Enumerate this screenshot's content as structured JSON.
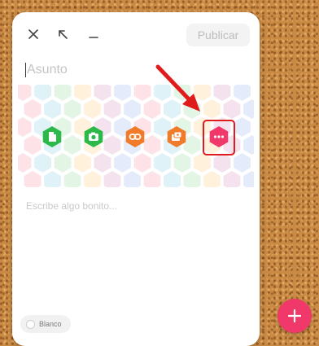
{
  "toolbar": {
    "close_icon": "close-icon",
    "expand_icon": "expand-arrow-icon",
    "minimize_icon": "minimize-icon",
    "publish_label": "Publicar"
  },
  "post": {
    "subject_placeholder": "Asunto",
    "body_placeholder": "Escribe algo bonito..."
  },
  "attachments": [
    {
      "icon": "document-icon",
      "color": "#2db84a"
    },
    {
      "icon": "camera-icon",
      "color": "#2db84a"
    },
    {
      "icon": "link-icon",
      "color": "#f07b2a"
    },
    {
      "icon": "photo-gallery-icon",
      "color": "#f07b2a"
    },
    {
      "icon": "more-options-icon",
      "color": "#f0386b"
    }
  ],
  "background_option": {
    "label": "Blanco"
  },
  "colors": {
    "accent": "#f0386b",
    "annotation": "#e01b1b"
  },
  "fab_icon": "plus-icon"
}
